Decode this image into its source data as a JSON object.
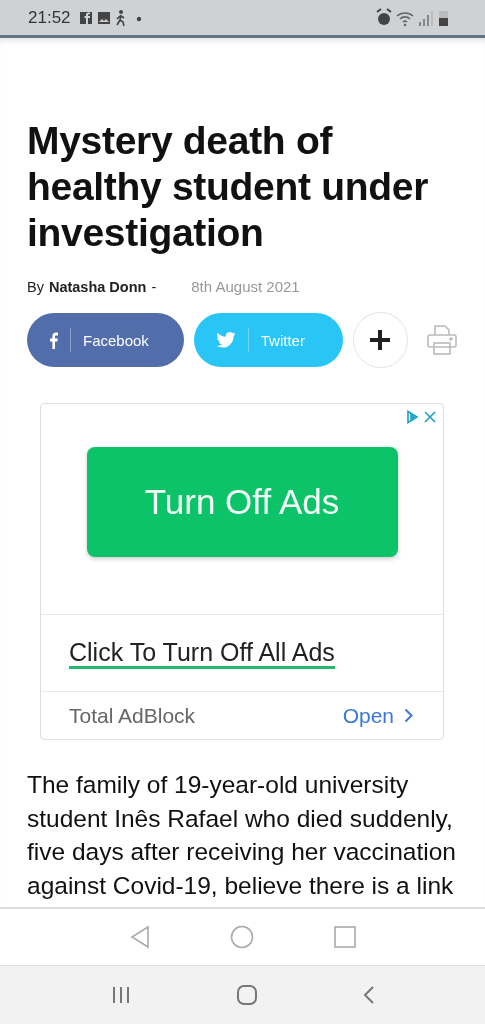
{
  "status_bar": {
    "time": "21:52"
  },
  "article": {
    "title": "Mystery death of healthy student under investigation",
    "byline": {
      "prefix": "By",
      "author": "Natasha Donn",
      "separator": "-",
      "date": "8th August 2021"
    },
    "share_buttons": [
      {
        "kind": "facebook",
        "label": "Facebook"
      },
      {
        "kind": "twitter",
        "label": "Twitter"
      },
      {
        "kind": "more"
      },
      {
        "kind": "print"
      }
    ],
    "body": "The family of 19-year-old university student Inês Rafael who died suddenly, five days after receiving her vaccination against Covid-19, believe there is a link"
  },
  "ad": {
    "button": "Turn Off Ads",
    "headline": "Click To Turn Off All Ads",
    "advertiser": "Total AdBlock",
    "action": "Open"
  }
}
